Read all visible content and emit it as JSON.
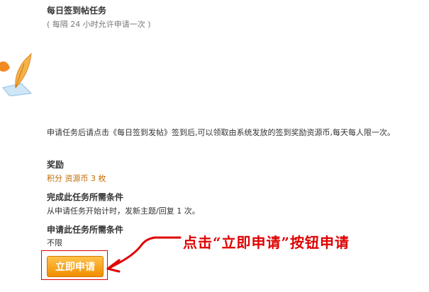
{
  "task": {
    "title": "每日签到帖任务",
    "interval": "( 每隔  24 小时允许申请一次  )",
    "icon": "quill-pen-icon",
    "description": "申请任务后请点击《每日签到发帖》签到后,可以领取由系统发放的签到奖励资源币,每天每人限一次。"
  },
  "reward": {
    "heading": "奖励",
    "text": "积分  资源币  3 枚"
  },
  "complete_condition": {
    "heading": "完成此任务所需条件",
    "text": "从申请任务开始计时，发新主题/回复  1 次。"
  },
  "apply_condition": {
    "heading": "申请此任务所需条件",
    "text": "不限"
  },
  "apply_button": {
    "label": "立即申请"
  },
  "annotation": {
    "text": "点击“立即申请”按钮申请",
    "color": "#e00000"
  },
  "colors": {
    "button": "#f5a300",
    "reward": "#c06a00",
    "annotation": "#e00000"
  }
}
